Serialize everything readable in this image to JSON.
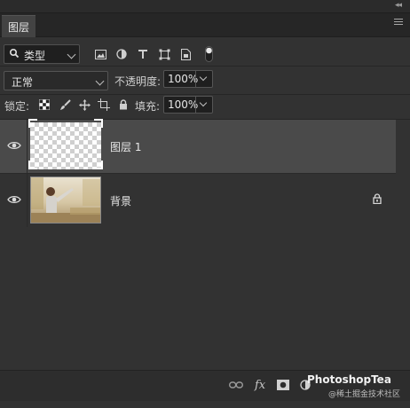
{
  "tab": {
    "label": "图层"
  },
  "filter": {
    "kind_label": "类型"
  },
  "blend": {
    "mode": "正常",
    "opacity_label": "不透明度:",
    "opacity_value": "100%"
  },
  "lock": {
    "label": "锁定:",
    "fill_label": "填充:",
    "fill_value": "100%"
  },
  "layers": [
    {
      "name": "图层 1",
      "selected": true,
      "visible": true,
      "locked": false
    },
    {
      "name": "背景",
      "selected": false,
      "visible": true,
      "locked": true
    }
  ],
  "watermark": {
    "title": "PhotoshopTea",
    "subtitle": "@稀土掘金技术社区"
  },
  "colors": {
    "panel": "#323232",
    "selected_row": "#4a4a4a",
    "tabbar": "#262626"
  }
}
